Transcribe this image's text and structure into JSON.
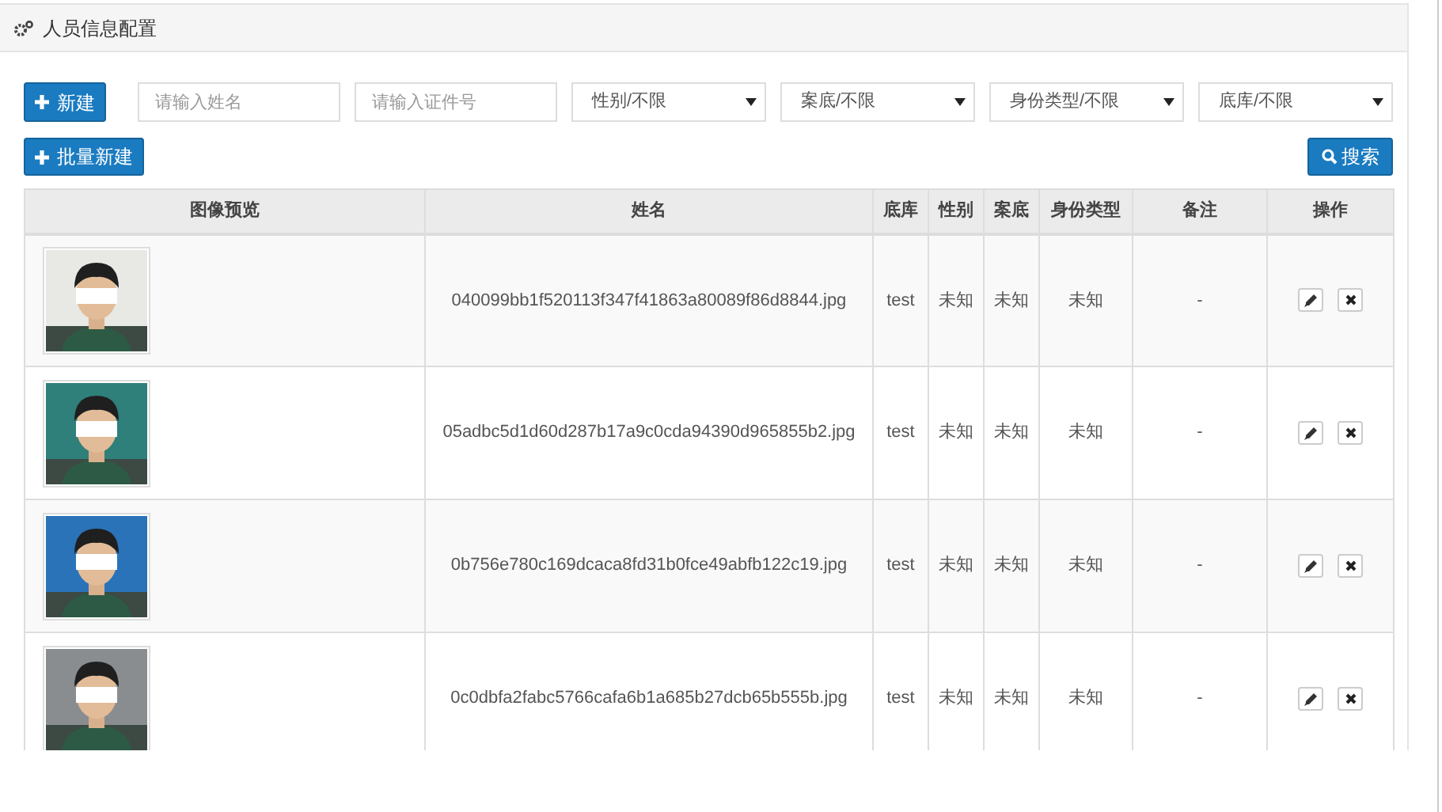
{
  "panel": {
    "title": "人员信息配置"
  },
  "toolbar": {
    "new_button": "新建",
    "batch_button": "批量新建",
    "search_button": "搜索",
    "fields": [
      {
        "placeholder": "请输入姓名"
      },
      {
        "placeholder": "请输入证件号"
      }
    ],
    "selects": [
      {
        "value": "性别/不限"
      },
      {
        "value": "案底/不限"
      },
      {
        "value": "身份类型/不限"
      },
      {
        "value": "底库/不限"
      }
    ]
  },
  "table": {
    "columns": [
      "图像预览",
      "姓名",
      "底库",
      "性别",
      "案底",
      "身份类型",
      "备注",
      "操作"
    ],
    "rows": [
      {
        "name": "040099bb1f520113f347f41863a80089f86d8844.jpg",
        "library": "test",
        "gender": "未知",
        "record": "未知",
        "id_type": "未知",
        "note": "-"
      },
      {
        "name": "05adbc5d1d60d287b17a9c0cda94390d965855b2.jpg",
        "library": "test",
        "gender": "未知",
        "record": "未知",
        "id_type": "未知",
        "note": "-"
      },
      {
        "name": "0b756e780c169dcaca8fd31b0fce49abfb122c19.jpg",
        "library": "test",
        "gender": "未知",
        "record": "未知",
        "id_type": "未知",
        "note": "-"
      },
      {
        "name": "0c0dbfa2fabc5766cafa6b1a685b27dcb65b555b.jpg",
        "library": "test",
        "gender": "未知",
        "record": "未知",
        "id_type": "未知",
        "note": "-"
      }
    ]
  }
}
